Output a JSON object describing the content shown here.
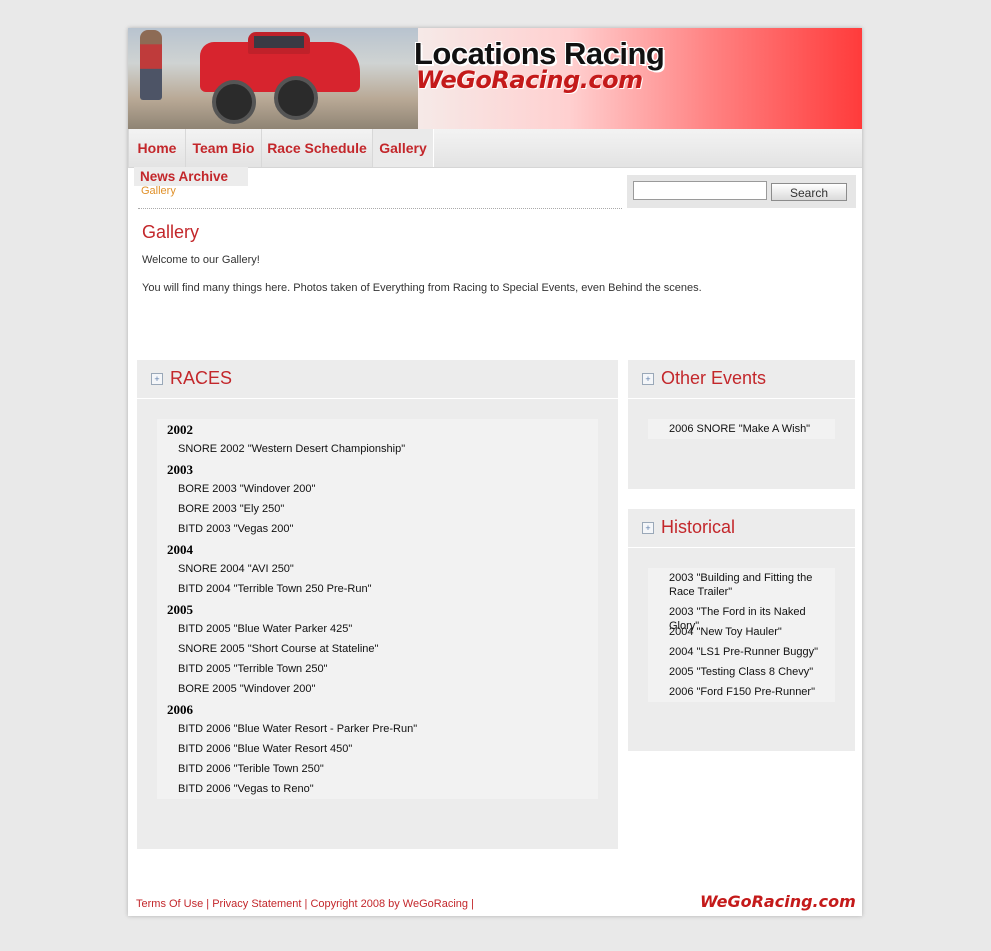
{
  "banner": {
    "title": "Locations Racing",
    "subtitle": "WeGoRacing.com"
  },
  "nav": {
    "items": [
      "Home",
      "Team Bio",
      "Race Schedule",
      "Gallery"
    ],
    "sub_item": "News Archive"
  },
  "breadcrumb": "Gallery",
  "search": {
    "value": "",
    "button": "Search"
  },
  "main": {
    "title": "Gallery",
    "paragraphs": [
      "Welcome to our Gallery!",
      "You will find many things here. Photos taken of Everything from Racing to Special Events, even Behind the scenes."
    ]
  },
  "races": {
    "title": "RACES",
    "groups": [
      {
        "year": "2002",
        "items": [
          "SNORE 2002 \"Western Desert Championship\""
        ]
      },
      {
        "year": "2003",
        "items": [
          "BORE 2003 \"Windover 200\"",
          "BORE 2003 \"Ely 250\"",
          "BITD 2003 \"Vegas 200\""
        ]
      },
      {
        "year": "2004",
        "items": [
          "SNORE 2004 \"AVI 250\"",
          "BITD 2004 \"Terrible Town 250 Pre-Run\""
        ]
      },
      {
        "year": "2005",
        "items": [
          "BITD 2005 \"Blue Water Parker 425\"",
          "SNORE 2005 \"Short Course at Stateline\"",
          "BITD 2005 \"Terrible Town 250\"",
          "BORE 2005 \"Windover 200\""
        ]
      },
      {
        "year": "2006",
        "items": [
          "BITD 2006 \"Blue Water Resort - Parker Pre-Run\"",
          "BITD 2006 \"Blue Water Resort 450\"",
          "BITD 2006 \"Terible Town 250\"",
          "BITD 2006 \"Vegas to Reno\""
        ]
      }
    ]
  },
  "other_events": {
    "title": "Other Events",
    "items": [
      "2006 SNORE \"Make A Wish\""
    ]
  },
  "historical": {
    "title": "Historical",
    "items": [
      "2003 \"Building and Fitting the Race Trailer\"",
      "2003 \"The Ford in its Naked Glory\"",
      "2004 \"New Toy Hauler\"",
      "2004 \"LS1 Pre-Runner Buggy\"",
      "2005 \"Testing Class 8 Chevy\"",
      "2006 \"Ford F150 Pre-Runner\""
    ]
  },
  "footer": {
    "terms": "Terms Of Use",
    "privacy": "Privacy Statement",
    "copyright": "Copyright 2008 by WeGoRacing",
    "sep": "|",
    "logo": "WeGoRacing.com"
  }
}
